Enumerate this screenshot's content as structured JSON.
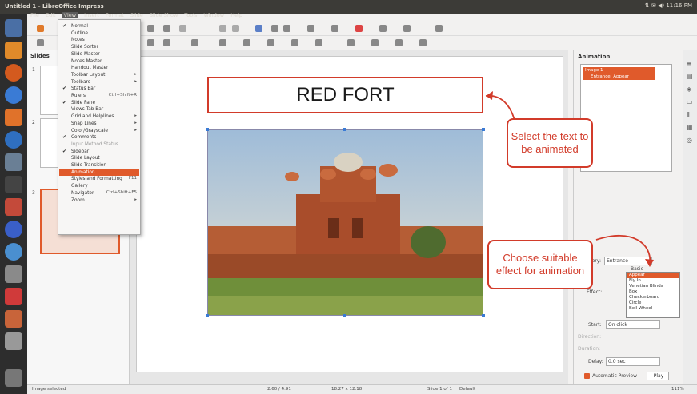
{
  "window_title": "Untitled 1 - LibreOffice Impress",
  "menus": [
    "File",
    "Edit",
    "View",
    "Insert",
    "Format",
    "Slide",
    "Slide Show",
    "Tools",
    "Window",
    "Help"
  ],
  "tray": {
    "clock": "11:16 PM",
    "extra": "⇅  ✉  ◀)"
  },
  "slides_pane": {
    "title": "Slides",
    "thumbs": [
      "1",
      "2",
      "3"
    ]
  },
  "view_menu": [
    {
      "label": "Normal",
      "checked": true
    },
    {
      "label": "Outline"
    },
    {
      "label": "Notes"
    },
    {
      "label": "Slide Sorter"
    },
    {
      "label": "Slide Master"
    },
    {
      "label": "Notes Master"
    },
    {
      "label": "Handout Master"
    },
    {
      "label": "Toolbar Layout",
      "submenu": true
    },
    {
      "label": "Toolbars",
      "submenu": true
    },
    {
      "label": "Status Bar",
      "checked": true
    },
    {
      "label": "Rulers",
      "shortcut": "Ctrl+Shift+R"
    },
    {
      "label": "Slide Pane",
      "checked": true
    },
    {
      "label": "Views Tab Bar"
    },
    {
      "label": "Grid and Helplines",
      "submenu": true
    },
    {
      "label": "Snap Lines",
      "submenu": true
    },
    {
      "label": "Color/Grayscale",
      "submenu": true
    },
    {
      "label": "Comments",
      "checked": true
    },
    {
      "label": "Input Method Status",
      "disabled": true
    },
    {
      "label": "Sidebar",
      "checked": true
    },
    {
      "label": "Slide Layout"
    },
    {
      "label": "Slide Transition"
    },
    {
      "label": "Animation",
      "highlighted": true
    },
    {
      "label": "Styles and Formatting",
      "shortcut": "F11"
    },
    {
      "label": "Gallery"
    },
    {
      "label": "Navigator",
      "shortcut": "Ctrl+Shift+F5"
    },
    {
      "label": "Zoom",
      "submenu": true
    }
  ],
  "slide": {
    "title": "RED FORT"
  },
  "sidebar": {
    "title": "Animation",
    "anim_items": [
      "Image 1",
      "Entrance: Appear"
    ],
    "category_label": "Category:",
    "category_value": "Entrance",
    "effect_label": "Effect:",
    "effect_group": "Basic",
    "effects": [
      "Appear",
      "Fly In",
      "Venetian Blinds",
      "Box",
      "Checkerboard",
      "Circle",
      "Bell Wheel"
    ],
    "start_label": "Start:",
    "start_value": "On click",
    "direction_label": "Direction:",
    "duration_label": "Duration:",
    "delay_label": "Delay:",
    "delay_value": "0.0 sec",
    "preview_label": "Automatic Preview",
    "play_label": "Play"
  },
  "status": {
    "left": "Image selected",
    "pos": "2.60 / 4.91",
    "size": "18.27 x 12.18",
    "slide": "Slide 1 of 1",
    "layout": "Default",
    "zoom": "111%"
  },
  "callouts": {
    "select": "Select the text to be animated",
    "choose": "Choose suitable effect for animation"
  },
  "colors": {
    "accent": "#e05a2b",
    "callout": "#d23b2a",
    "topbar": "#3c3b37",
    "launcher": "#2d2d2d"
  }
}
